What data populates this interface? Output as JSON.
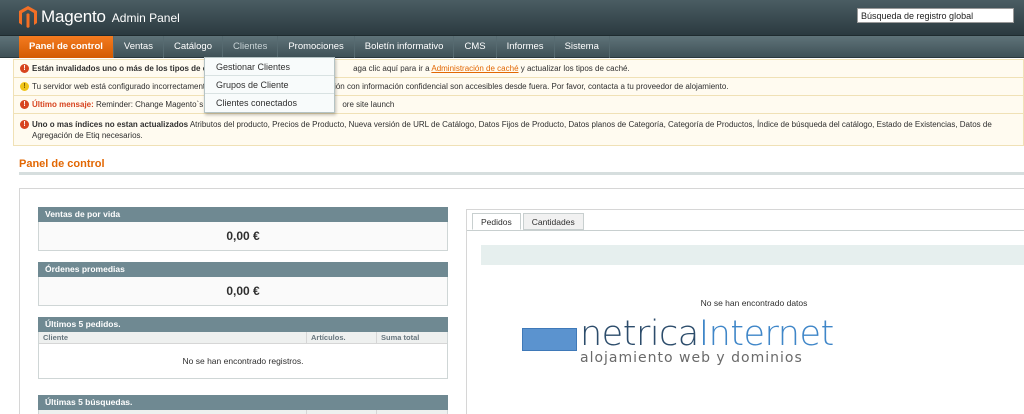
{
  "header": {
    "logo_text": "Magento",
    "logo_sub": "Admin Panel",
    "search_value": "Búsqueda de registro global"
  },
  "nav": {
    "items": [
      {
        "label": "Panel de control"
      },
      {
        "label": "Ventas"
      },
      {
        "label": "Catálogo"
      },
      {
        "label": "Clientes"
      },
      {
        "label": "Promociones"
      },
      {
        "label": "Boletín informativo"
      },
      {
        "label": "CMS"
      },
      {
        "label": "Informes"
      },
      {
        "label": "Sistema"
      }
    ],
    "active": "Panel de control",
    "open": "Clientes"
  },
  "dropdown": {
    "items": [
      {
        "label": "Gestionar Clientes"
      },
      {
        "label": "Grupos de Cliente"
      },
      {
        "label": "Clientes conectados"
      }
    ]
  },
  "messages": {
    "m1": {
      "bold": "Están invalidados uno o más de los tipos de ca",
      "hidden": "",
      "text_after": "aga clic aquí para ir a",
      "link": "Administración de caché",
      "text_end": "y actualizar los tipos de caché."
    },
    "m2": {
      "text_before": "Tu servidor web está configurado incorrectamente",
      "text_after": "guración con información confidencial son accesibles desde fuera. Por favor, contacta a tu proveedor de alojamiento."
    },
    "m3": {
      "label": "Último mensaje:",
      "text_before": "Reminder: Change Magento`s d",
      "text_after": "ore site launch"
    },
    "m4": {
      "bold": "Uno o mas índices no estan actualizados",
      "text": "Atributos del producto, Precios de Producto, Nueva versión de URL de Catálogo, Datos Fijos de Producto, Datos planos de Categoría, Categoría de Productos, Índice de búsqueda del catálogo, Estado de Existencias, Datos de Agregación de Etiq necesarios."
    }
  },
  "page": {
    "title": "Panel de control"
  },
  "boxes": {
    "lifetime_sales": {
      "title": "Ventas de por vida",
      "value": "0,00 €"
    },
    "avg_orders": {
      "title": "Órdenes promedias",
      "value": "0,00 €"
    },
    "last_orders": {
      "title": "Últimos 5 pedidos.",
      "columns": [
        "Cliente",
        "Artículos.",
        "Suma total"
      ],
      "empty": "No se han encontrado registros."
    },
    "last_searches": {
      "title": "Últimas 5 búsquedas."
    }
  },
  "right_panel": {
    "tabs": [
      {
        "label": "Pedidos"
      },
      {
        "label": "Cantidades"
      }
    ],
    "no_data": "No se han encontrado datos"
  },
  "watermark": {
    "name_a": "netrica",
    "name_b": "Internet",
    "tagline": "alojamiento web y dominios"
  },
  "colors": {
    "accent": "#e26703",
    "nav_active": "#f47b20",
    "box_head": "#6f8992",
    "header_bg": "#2b3a40"
  }
}
